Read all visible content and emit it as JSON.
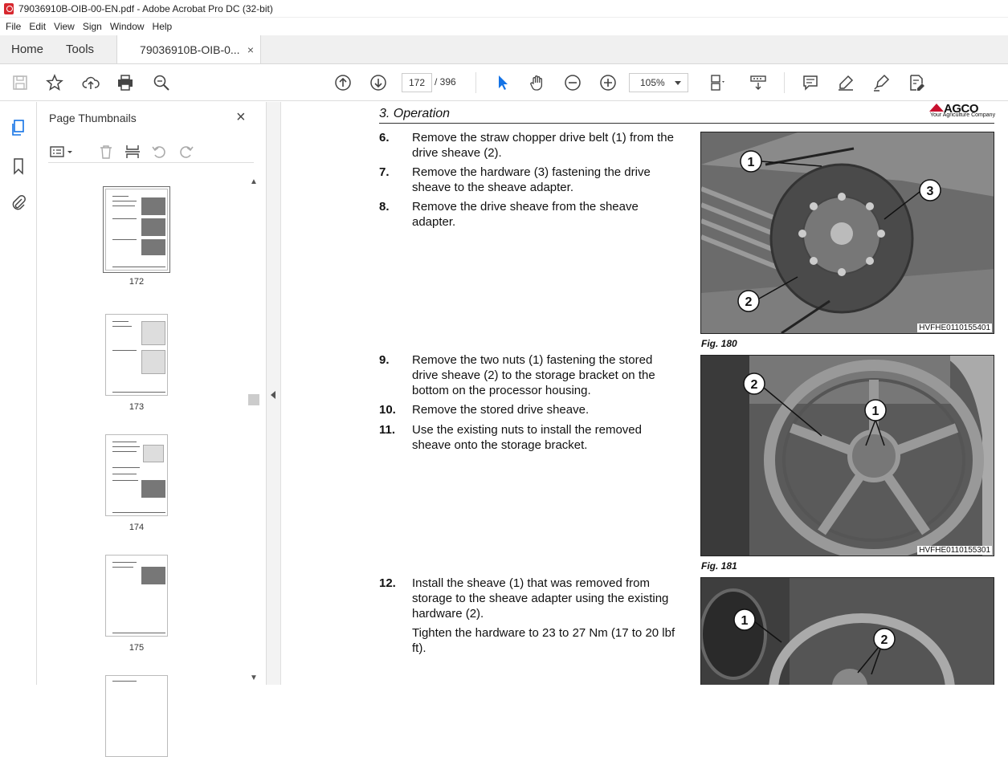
{
  "window": {
    "title": "79036910B-OIB-00-EN.pdf - Adobe Acrobat Pro DC (32-bit)"
  },
  "menu": [
    "File",
    "Edit",
    "View",
    "Sign",
    "Window",
    "Help"
  ],
  "tabs": {
    "home": "Home",
    "tools": "Tools",
    "document": "79036910B-OIB-0...",
    "close": "×"
  },
  "toolbar": {
    "page_current": "172",
    "page_total": "/ 396",
    "zoom": "105%"
  },
  "panel": {
    "title": "Page Thumbnails",
    "close": "×",
    "thumbnails": [
      {
        "label": "172",
        "selected": true
      },
      {
        "label": "173",
        "selected": false
      },
      {
        "label": "174",
        "selected": false
      },
      {
        "label": "175",
        "selected": false
      }
    ]
  },
  "document": {
    "section": "3. Operation",
    "logo": {
      "brand": "AGCO",
      "tagline": "Your Agriculture Company"
    },
    "steps": [
      {
        "num": "6.",
        "text": "Remove the straw chopper drive belt (1) from the drive sheave (2)."
      },
      {
        "num": "7.",
        "text": "Remove the hardware (3) fastening the drive sheave to the sheave adapter."
      },
      {
        "num": "8.",
        "text": "Remove the drive sheave from the sheave adapter."
      },
      {
        "num": "9.",
        "text": "Remove the two nuts (1) fastening the stored drive sheave (2) to the storage bracket on the bottom on the processor housing."
      },
      {
        "num": "10.",
        "text": "Remove the stored drive sheave."
      },
      {
        "num": "11.",
        "text": "Use the existing nuts to install the removed sheave onto the storage bracket."
      },
      {
        "num": "12.",
        "text": "Install the sheave (1) that was removed from storage to the sheave adapter using the existing hardware (2).",
        "extra": "Tighten the hardware to 23 to 27 Nm (17 to 20 lbf ft)."
      }
    ],
    "figures": [
      {
        "caption": "Fig. 180",
        "code": "HVFHE0110155401",
        "callouts": [
          "1",
          "3",
          "2"
        ]
      },
      {
        "caption": "Fig. 181",
        "code": "HVFHE0110155301",
        "callouts": [
          "2",
          "1"
        ]
      },
      {
        "caption": "",
        "code": "",
        "callouts": [
          "1",
          "2"
        ]
      }
    ]
  }
}
